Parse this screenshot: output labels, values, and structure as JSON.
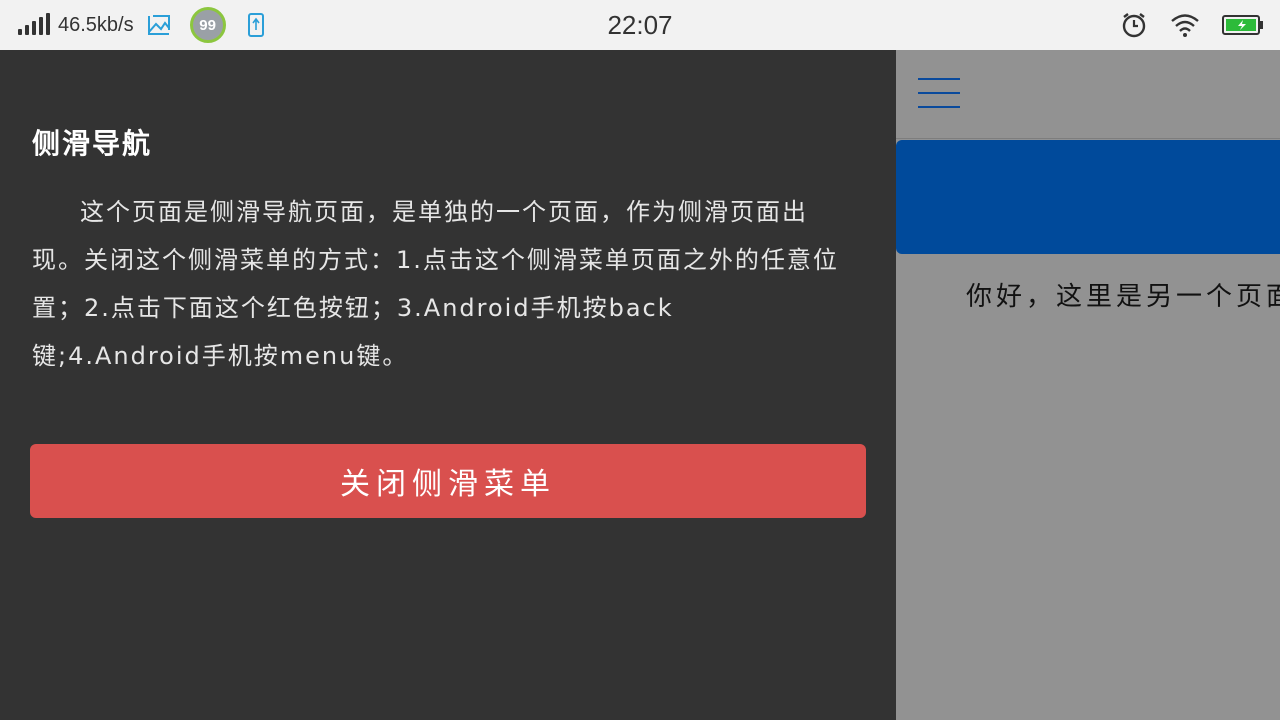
{
  "status_bar": {
    "network_speed": "46.5kb/s",
    "badge_value": "99",
    "time": "22:07",
    "icons": [
      "signal-icon",
      "image-icon",
      "usb-icon",
      "alarm-icon",
      "wifi-icon",
      "battery-icon"
    ],
    "colors": {
      "badge_ring": "#8cc63f",
      "battery": "#2dbb3a",
      "accent": "#2b9fd8"
    }
  },
  "side_menu": {
    "title": "侧滑导航",
    "description": "这个页面是侧滑导航页面，是单独的一个页面，作为侧滑页面出现。关闭这个侧滑菜单的方式：1.点击这个侧滑菜单页面之外的任意位置；2.点击下面这个红色按钮；3.Android手机按back键;4.Android手机按menu键。",
    "close_button_label": "关闭侧滑菜单",
    "colors": {
      "background": "#333333",
      "button": "#d9504e"
    }
  },
  "main_page": {
    "text": "你好，这里是另一个页面",
    "colors": {
      "banner": "#004a9b",
      "menu_icon": "#0a4a9c",
      "background": "#929292"
    }
  }
}
